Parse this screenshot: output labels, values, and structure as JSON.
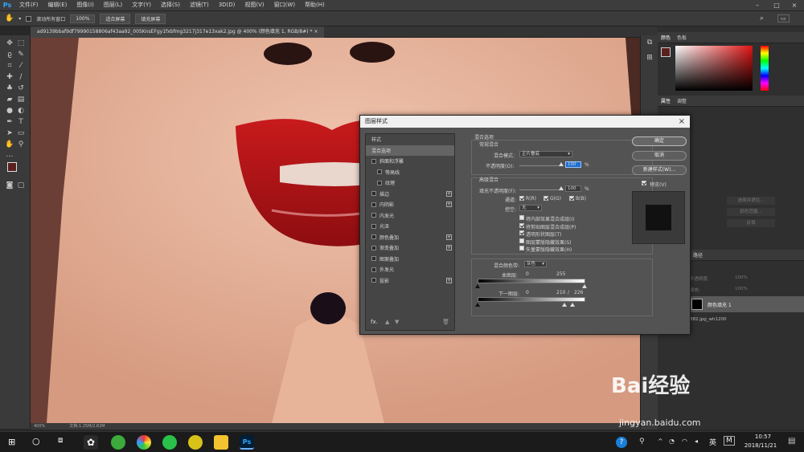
{
  "app": {
    "logo": "Ps"
  },
  "menu": [
    "文件(F)",
    "编辑(E)",
    "图像(I)",
    "图层(L)",
    "文字(Y)",
    "选择(S)",
    "滤镜(T)",
    "3D(D)",
    "视图(V)",
    "窗口(W)",
    "帮助(H)"
  ],
  "options": {
    "scroll_all": "滚动所有窗口",
    "zoom": "100%",
    "fit_screen": "适合屏幕",
    "fill_screen": "填充屏幕"
  },
  "doc_tab": "ad9139bbaf9df79990158806af43aa92_005KnsEFgy1fxbfmg3217j317e13xak2.jpg @ 400% (颜色填充 1, RGB/8#) *",
  "status": {
    "zoom": "400%",
    "doc": "文档:1.25M/2.82M"
  },
  "panels": {
    "color_tabs": [
      "颜色",
      "色板"
    ],
    "props_tabs": [
      "属性",
      "调整"
    ],
    "layers_tab": "路径",
    "layer_row": "颜色填充 1",
    "layer_name2": "382.jpg_wh1200",
    "dimmed": [
      "选择并遮住...",
      "颜色范围...",
      "反相",
      "不透明度:",
      "填充:",
      "100%",
      "100%"
    ]
  },
  "dialog": {
    "title": "图层样式",
    "styles_header": "样式",
    "styles": [
      {
        "label": "混合选项",
        "check": false,
        "plus": false,
        "sel": true
      },
      {
        "label": "斜面和浮雕",
        "check": true,
        "plus": false
      },
      {
        "label": "等高线",
        "check": true,
        "plus": false,
        "indent": true
      },
      {
        "label": "纹理",
        "check": true,
        "plus": false,
        "indent": true
      },
      {
        "label": "描边",
        "check": true,
        "plus": true
      },
      {
        "label": "内阴影",
        "check": true,
        "plus": true
      },
      {
        "label": "内发光",
        "check": true,
        "plus": false
      },
      {
        "label": "光泽",
        "check": true,
        "plus": false
      },
      {
        "label": "颜色叠加",
        "check": true,
        "plus": true
      },
      {
        "label": "渐变叠加",
        "check": true,
        "plus": true
      },
      {
        "label": "图案叠加",
        "check": true,
        "plus": false
      },
      {
        "label": "外发光",
        "check": true,
        "plus": false
      },
      {
        "label": "投影",
        "check": true,
        "plus": true
      }
    ],
    "fx": "fx.",
    "blend_options": "混合选项",
    "general": "常规混合",
    "blend_mode_label": "混合模式:",
    "blend_mode": "正片叠底",
    "opacity_label": "不透明度(O):",
    "opacity": "100",
    "pct": "%",
    "advanced": "高级混合",
    "fill_label": "填充不透明度(F):",
    "fill": "100",
    "channels_label": "通道:",
    "ch": [
      "R(R)",
      "G(G)",
      "B(B)"
    ],
    "knockout_label": "挖空:",
    "knockout": "无",
    "adv_checks": [
      {
        "label": "将内部效果混合成组(I)",
        "on": false
      },
      {
        "label": "将剪贴图层混合成组(P)",
        "on": true
      },
      {
        "label": "透明形状图层(T)",
        "on": true
      },
      {
        "label": "图层蒙版隐藏效果(S)",
        "on": false
      },
      {
        "label": "矢量蒙版隐藏效果(H)",
        "on": false
      }
    ],
    "blend_if_label": "混合颜色带:",
    "blend_if": "灰色",
    "this_layer": "本图层:",
    "this_min": "0",
    "this_max": "255",
    "under_layer": "下一图层:",
    "under_min": "0",
    "under_max1": "210",
    "slash": "/",
    "under_max2": "226",
    "ok": "确定",
    "cancel": "取消",
    "new_style": "新建样式(W)...",
    "preview": "预览(V)"
  },
  "taskbar": {
    "time": "10:57",
    "date": "2018/11/21",
    "ime": "英",
    "m": "M"
  },
  "watermark": {
    "brand": "Bai经验",
    "url": "jingyan.baidu.com"
  }
}
